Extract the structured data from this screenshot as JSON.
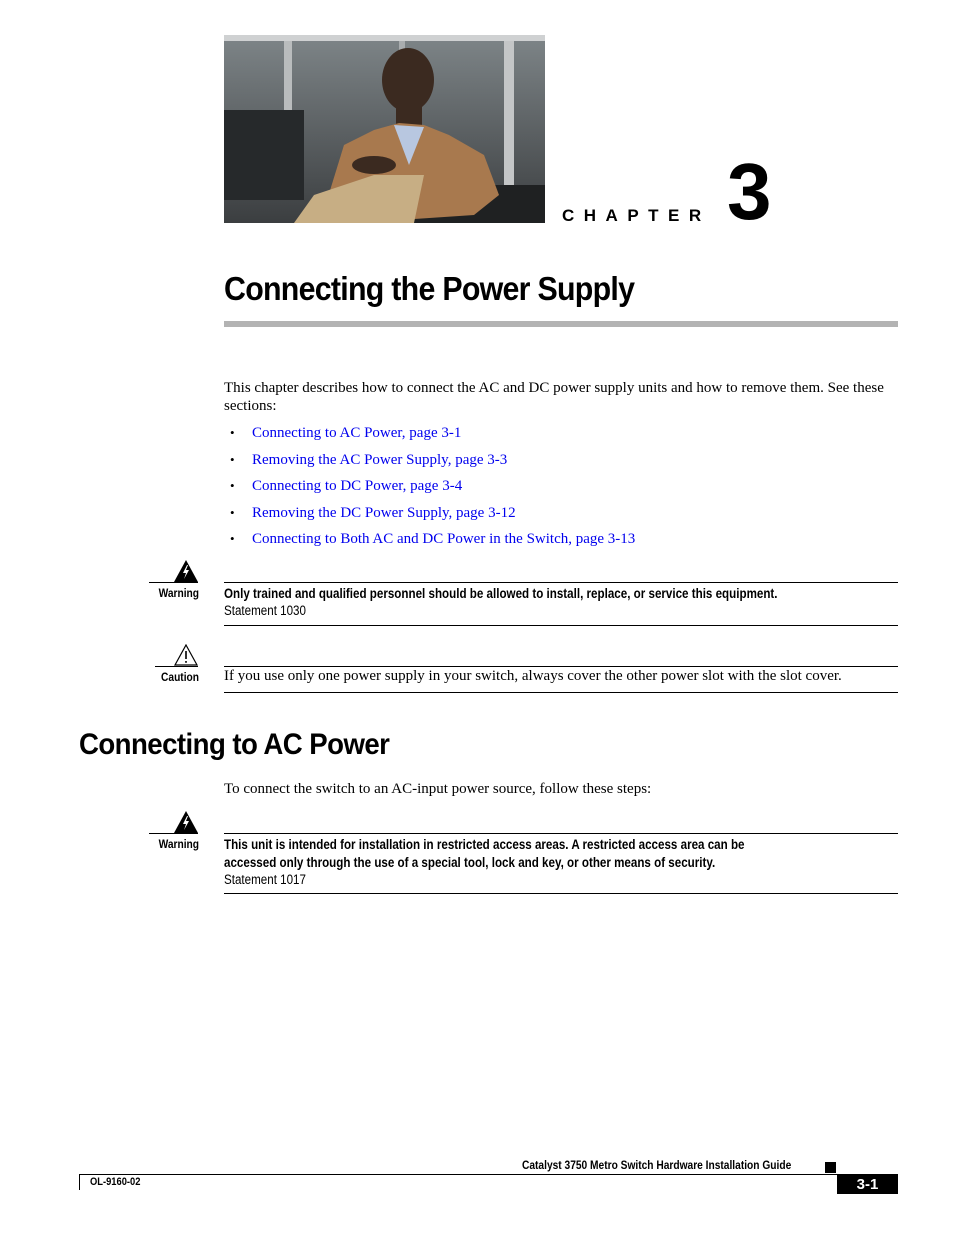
{
  "chapter": {
    "label": "CHAPTER",
    "number": "3",
    "title": "Connecting the Power Supply",
    "photo_alt": "man-seated-portrait-photo"
  },
  "intro": {
    "text": "This chapter describes how to connect the AC and DC power supply units and how to remove them. See these sections:",
    "bullet": "•",
    "links": [
      {
        "label": "Connecting to AC Power, page 3-1"
      },
      {
        "label": "Removing the AC Power Supply, page 3-3"
      },
      {
        "label": "Connecting to DC Power, page 3-4"
      },
      {
        "label": "Removing the DC Power Supply, page 3-12"
      },
      {
        "label": "Connecting to Both AC and DC Power in the Switch, page 3-13"
      }
    ]
  },
  "notices": {
    "warning1": {
      "label": "Warning",
      "text": "Only trained and qualified personnel should be allowed to install, replace, or service this equipment.",
      "statement": "Statement 1030"
    },
    "caution1": {
      "label": "Caution",
      "text": "If you use only one power supply in your switch, always cover the other power slot with the slot cover."
    },
    "warning2": {
      "label": "Warning",
      "text_line1": "This unit is intended for installation in restricted access areas. A restricted access area can be",
      "text_line2": "accessed only through the use of a special tool, lock and key, or other means of security.",
      "statement": "Statement 1017"
    }
  },
  "section": {
    "title": "Connecting to AC Power",
    "body": "To connect the switch to an AC-input power source, follow these steps:"
  },
  "footer": {
    "guide_title": "Catalyst 3750 Metro Switch Hardware Installation Guide",
    "doc_number": "OL-9160-02",
    "page": "3-1"
  },
  "colors": {
    "link": "#0000ee",
    "title_rule": "#b3b3b3"
  }
}
